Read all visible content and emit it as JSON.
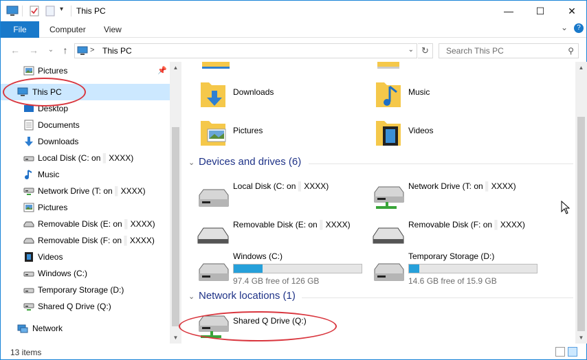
{
  "window": {
    "title": "This PC",
    "minimize_glyph": "—",
    "maximize_glyph": "☐",
    "close_glyph": "✕"
  },
  "ribbon": {
    "tabs": [
      {
        "label": "File"
      },
      {
        "label": "Computer"
      },
      {
        "label": "View"
      }
    ],
    "expand_glyph": "⌄",
    "help_glyph": "?"
  },
  "nav": {
    "back_glyph": "←",
    "forward_glyph": "→",
    "recent_glyph": "⌄",
    "up_glyph": "↑",
    "address_chevron": ">",
    "address": "This PC",
    "address_dropdown": "⌄",
    "refresh_glyph": "↻",
    "search_placeholder": "Search This PC",
    "search_glyph": "⚲"
  },
  "sidebar": {
    "items": [
      {
        "label": "Pictures",
        "icon": "pictures-icon",
        "pinned": true
      },
      {
        "label": "This PC",
        "icon": "this-pc-icon",
        "selected": true
      },
      {
        "label": "Desktop",
        "icon": "desktop-icon"
      },
      {
        "label": "Documents",
        "icon": "documents-icon"
      },
      {
        "label": "Downloads",
        "icon": "downloads-icon"
      },
      {
        "label": "Local Disk (C: on",
        "suffix": "XXXX)",
        "icon": "local-disk-icon"
      },
      {
        "label": "Music",
        "icon": "music-icon"
      },
      {
        "label": "Network Drive (T: on",
        "suffix": "XXXX)",
        "icon": "network-drive-icon"
      },
      {
        "label": "Pictures",
        "icon": "pictures-icon"
      },
      {
        "label": "Removable Disk (E: on",
        "suffix": "XXXX)",
        "icon": "removable-disk-icon"
      },
      {
        "label": "Removable Disk (F: on",
        "suffix": "XXXX)",
        "icon": "removable-disk-icon"
      },
      {
        "label": "Videos",
        "icon": "videos-icon"
      },
      {
        "label": "Windows (C:)",
        "icon": "drive-icon"
      },
      {
        "label": "Temporary Storage (D:)",
        "icon": "drive-icon"
      },
      {
        "label": "Shared Q Drive (Q:)",
        "icon": "network-drive-icon"
      },
      {
        "label": "Network",
        "icon": "network-icon"
      }
    ]
  },
  "folders": [
    {
      "label": "Downloads",
      "icon": "downloads-folder-icon"
    },
    {
      "label": "Music",
      "icon": "music-folder-icon"
    },
    {
      "label": "Pictures",
      "icon": "pictures-folder-icon"
    },
    {
      "label": "Videos",
      "icon": "videos-folder-icon"
    }
  ],
  "devices": {
    "title": "Devices and drives (6)",
    "items": [
      {
        "label": "Local Disk (C: on",
        "suffix": "XXXX)",
        "icon": "local-disk-icon"
      },
      {
        "label": "Network Drive (T: on",
        "suffix": "XXXX)",
        "icon": "network-drive-icon"
      },
      {
        "label": "Removable Disk (E: on",
        "suffix": "XXXX)",
        "icon": "removable-disk-icon"
      },
      {
        "label": "Removable Disk (F: on",
        "suffix": "XXXX)",
        "icon": "removable-disk-icon"
      },
      {
        "label": "Windows (C:)",
        "icon": "drive-icon",
        "used_fraction": 0.227,
        "free_text": "97.4 GB free of 126 GB"
      },
      {
        "label": "Temporary Storage (D:)",
        "icon": "drive-icon",
        "used_fraction": 0.082,
        "free_text": "14.6 GB free of 15.9 GB"
      }
    ]
  },
  "network": {
    "title": "Network locations (1)",
    "items": [
      {
        "label": "Shared Q Drive (Q:)",
        "icon": "network-drive-icon"
      }
    ]
  },
  "status": {
    "item_count": "13 items"
  },
  "colors": {
    "accent": "#1979ca",
    "selection": "#cce8ff",
    "annotation": "#d9363e",
    "bar_fill": "#26a0da",
    "section_title": "#1e3287"
  }
}
